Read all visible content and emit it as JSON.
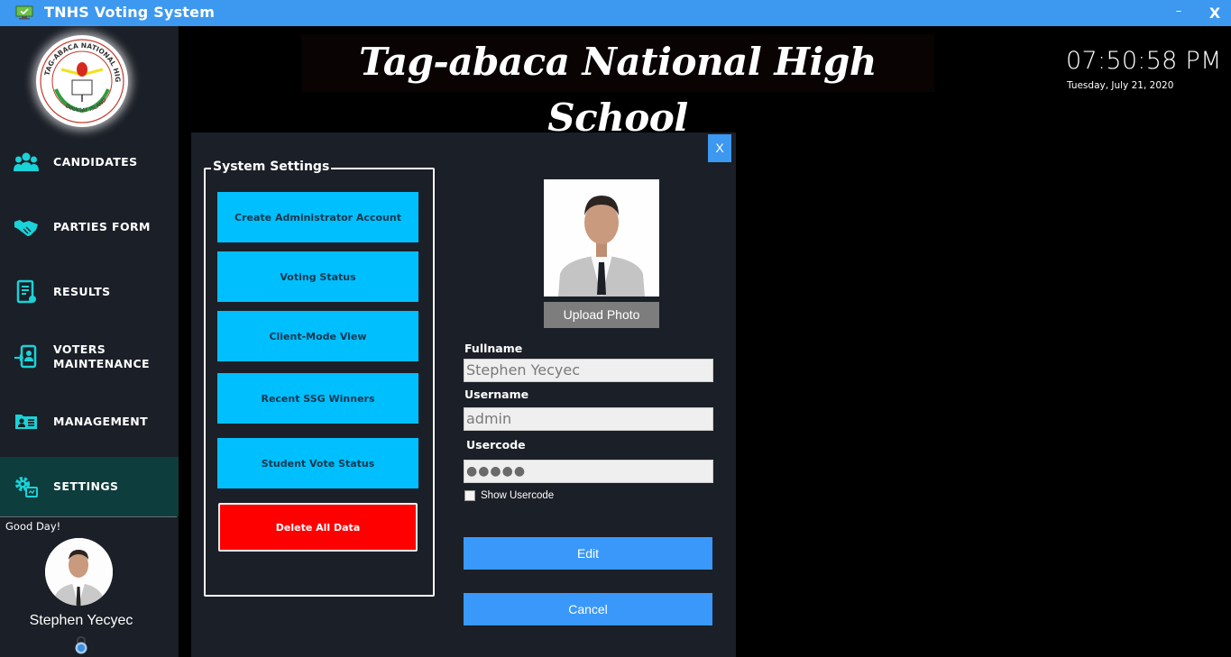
{
  "window": {
    "title": "TNHS Voting System",
    "minimize_label": "–",
    "close_label": "X"
  },
  "header": {
    "school_name": "Tag-abaca National High School",
    "time": "07:50:58 PM",
    "date": "Tuesday, July 21, 2020"
  },
  "sidebar": {
    "logo_text": "TAG-ABACA NATIONAL HIGH SCHOOL · DINAGAT ISLANDS",
    "items": [
      {
        "label": "CANDIDATES",
        "icon": "users-icon"
      },
      {
        "label": "PARTIES FORM",
        "icon": "handshake-icon"
      },
      {
        "label": "RESULTS",
        "icon": "document-icon"
      },
      {
        "label": "VOTERS\nMAINTENANCE",
        "line1": "VOTERS",
        "line2": "MAINTENANCE",
        "icon": "user-login-icon"
      },
      {
        "label": "MANAGEMENT",
        "icon": "id-card-icon"
      },
      {
        "label": "SETTINGS",
        "icon": "settings-icon",
        "active": true
      }
    ],
    "greeting": "Good Day!",
    "user_name": "Stephen Yecyec"
  },
  "settings_panel": {
    "close_label": "X",
    "group_title": "System Settings",
    "buttons": [
      "Create Administrator Account",
      "Voting Status",
      "Client-Mode View",
      "Recent SSG Winners",
      "Student Vote Status"
    ],
    "danger_button": "Delete All Data",
    "upload_photo_label": "Upload Photo",
    "fullname_label": "Fullname",
    "fullname_value": "Stephen Yecyec",
    "username_label": "Username",
    "username_value": "admin",
    "usercode_label": "Usercode",
    "usercode_value": "●●●●●",
    "show_usercode_label": "Show Usercode",
    "show_usercode_checked": false,
    "edit_label": "Edit",
    "cancel_label": "Cancel"
  },
  "colors": {
    "titlebar": "#3d98f0",
    "sidebar_bg": "#1b1f27",
    "sidebar_active": "#0d3d3c",
    "icon_accent": "#19d3d8",
    "settings_button": "#00bfff",
    "danger_button": "#ff0000",
    "action_button": "#3a98fa"
  }
}
